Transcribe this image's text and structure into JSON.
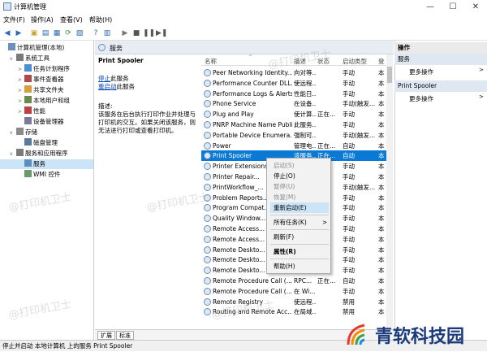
{
  "window": {
    "title": "计算机管理",
    "min": "—",
    "max": "☐",
    "close": "✕"
  },
  "menu": [
    "文件(F)",
    "操作(A)",
    "查看(V)",
    "帮助(H)"
  ],
  "tree": [
    {
      "label": "计算机管理(本地)",
      "level": 0,
      "twisty": ""
    },
    {
      "label": "系统工具",
      "level": 1,
      "twisty": "v"
    },
    {
      "label": "任务计划程序",
      "level": 2,
      "twisty": ">"
    },
    {
      "label": "事件查看器",
      "level": 2,
      "twisty": ">"
    },
    {
      "label": "共享文件夹",
      "level": 2,
      "twisty": ">"
    },
    {
      "label": "本地用户和组",
      "level": 2,
      "twisty": ">"
    },
    {
      "label": "性能",
      "level": 2,
      "twisty": ">"
    },
    {
      "label": "设备管理器",
      "level": 2,
      "twisty": ""
    },
    {
      "label": "存储",
      "level": 1,
      "twisty": "v"
    },
    {
      "label": "磁盘管理",
      "level": 2,
      "twisty": ""
    },
    {
      "label": "服务和应用程序",
      "level": 1,
      "twisty": "v"
    },
    {
      "label": "服务",
      "level": 2,
      "twisty": "",
      "selected": true
    },
    {
      "label": "WMI 控件",
      "level": 2,
      "twisty": ""
    }
  ],
  "center_header": "服务",
  "desc": {
    "service_name": "Print Spooler",
    "stop_link": "停止",
    "stop_suffix": "此服务",
    "restart_link": "重启动",
    "restart_suffix": "此服务",
    "desc_label": "描述:",
    "desc_text": "该服务在后台执行打印作业并处理与打印机的交互。如果关闭该服务，则无法进行打印或查看打印机。"
  },
  "columns": [
    "名称",
    "描述",
    "状态",
    "启动类型",
    "登"
  ],
  "services": [
    {
      "name": "Peer Networking Identity...",
      "desc": "向对等...",
      "status": "",
      "startup": "手动",
      "logon": "本"
    },
    {
      "name": "Performance Counter DLL...",
      "desc": "使远程...",
      "status": "",
      "startup": "手动",
      "logon": "本"
    },
    {
      "name": "Performance Logs & Alerts",
      "desc": "性能日...",
      "status": "",
      "startup": "手动",
      "logon": "本"
    },
    {
      "name": "Phone Service",
      "desc": "在设备...",
      "status": "",
      "startup": "手动(触发...",
      "logon": "本"
    },
    {
      "name": "Plug and Play",
      "desc": "使计算...",
      "status": "正在...",
      "startup": "手动",
      "logon": "本"
    },
    {
      "name": "PNRP Machine Name Publi...",
      "desc": "此服务...",
      "status": "",
      "startup": "手动",
      "logon": "本"
    },
    {
      "name": "Portable Device Enumera...",
      "desc": "强制可...",
      "status": "",
      "startup": "手动(触发...",
      "logon": "本"
    },
    {
      "name": "Power",
      "desc": "管理电...",
      "status": "正在...",
      "startup": "自动",
      "logon": "本"
    },
    {
      "name": "Print Spooler",
      "desc": "该服务...",
      "status": "正在...",
      "startup": "自动",
      "logon": "本",
      "selected": true
    },
    {
      "name": "Printer Extensions...",
      "desc": "",
      "status": "",
      "startup": "手动",
      "logon": "本"
    },
    {
      "name": "Printer Repair...",
      "desc": "",
      "status": "",
      "startup": "手动",
      "logon": "本"
    },
    {
      "name": "PrintWorkflow_...",
      "desc": "",
      "status": "",
      "startup": "手动(触发...",
      "logon": "本"
    },
    {
      "name": "Problem Reports...",
      "desc": "",
      "status": "",
      "startup": "手动",
      "logon": "本"
    },
    {
      "name": "Program Compat...",
      "desc": "",
      "status": "",
      "startup": "手动",
      "logon": "本"
    },
    {
      "name": "Quality Window...",
      "desc": "",
      "status": "",
      "startup": "手动",
      "logon": "本"
    },
    {
      "name": "Remote Access...",
      "desc": "",
      "status": "",
      "startup": "手动",
      "logon": "本"
    },
    {
      "name": "Remote Access...",
      "desc": "",
      "status": "",
      "startup": "手动",
      "logon": "本"
    },
    {
      "name": "Remote Deskto...",
      "desc": "",
      "status": "",
      "startup": "手动",
      "logon": "本"
    },
    {
      "name": "Remote Deskto...",
      "desc": "",
      "status": "",
      "startup": "手动",
      "logon": "本"
    },
    {
      "name": "Remote Deskto...",
      "desc": "",
      "status": "",
      "startup": "手动",
      "logon": "本"
    },
    {
      "name": "Remote Procedure Call (...",
      "desc": "RPC...",
      "status": "正在...",
      "startup": "自动",
      "logon": "本"
    },
    {
      "name": "Remote Procedure Call (...",
      "desc": "在 Wi...",
      "status": "",
      "startup": "手动",
      "logon": "本"
    },
    {
      "name": "Remote Registry",
      "desc": "使远程...",
      "status": "",
      "startup": "禁用",
      "logon": "本"
    },
    {
      "name": "Routing and Remote Acc...",
      "desc": "在局域...",
      "status": "",
      "startup": "禁用",
      "logon": "本"
    }
  ],
  "context_menu": {
    "start": "启动(S)",
    "stop": "停止(O)",
    "pause": "暂停(U)",
    "resume": "恢复(M)",
    "restart": "重新启动(E)",
    "all_tasks": "所有任务(K)",
    "all_tasks_arrow": ">",
    "refresh": "刷新(F)",
    "properties": "属性(R)",
    "help": "帮助(H)"
  },
  "tabs": [
    "扩展",
    "标准"
  ],
  "actions": {
    "title": "操作",
    "sections": [
      {
        "header": "服务",
        "items": [
          "更多操作"
        ]
      },
      {
        "header": "Print Spooler",
        "items": [
          "更多操作"
        ]
      }
    ]
  },
  "status": "停止并启动 本地计算机 上的服务 Print Spooler",
  "watermark": "@打印机卫士",
  "logo": "青软科技园"
}
